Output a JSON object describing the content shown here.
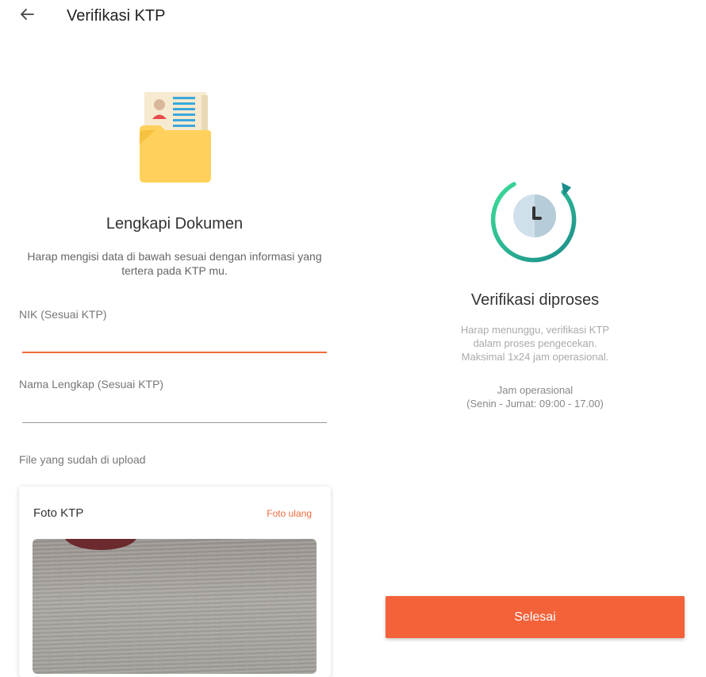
{
  "header": {
    "back_icon": "arrow-left-icon",
    "title": "Verifikasi KTP"
  },
  "document_form": {
    "illustration_icon": "document-folder-icon",
    "heading": "Lengkapi Dokumen",
    "description": "Harap mengisi data di bawah sesuai dengan informasi yang tertera pada KTP mu.",
    "nik_field": {
      "label": "NIK (Sesuai KTP)",
      "value": ""
    },
    "name_field": {
      "label": "Nama Lengkap (Sesuai KTP)",
      "value": ""
    },
    "uploaded_label": "File yang sudah di upload",
    "upload_card": {
      "title": "Foto KTP",
      "retake_label": "Foto ulang"
    }
  },
  "verification_status": {
    "illustration_icon": "clock-refresh-icon",
    "heading": "Verifikasi diproses",
    "desc_line1": "Harap menunggu, verifikasi KTP",
    "desc_line2": "dalam proses pengecekan.",
    "desc_line3": "Maksimal 1x24 jam operasional.",
    "hours_title": "Jam operasional",
    "hours_value": "(Senin - Jumat: 09:00 - 17.00)",
    "done_button": "Selesai"
  },
  "colors": {
    "accent": "#f4623a",
    "input_active_line": "#f06a3c",
    "clock_ring_start": "#3ddc97",
    "clock_ring_end": "#1b8c8c"
  }
}
